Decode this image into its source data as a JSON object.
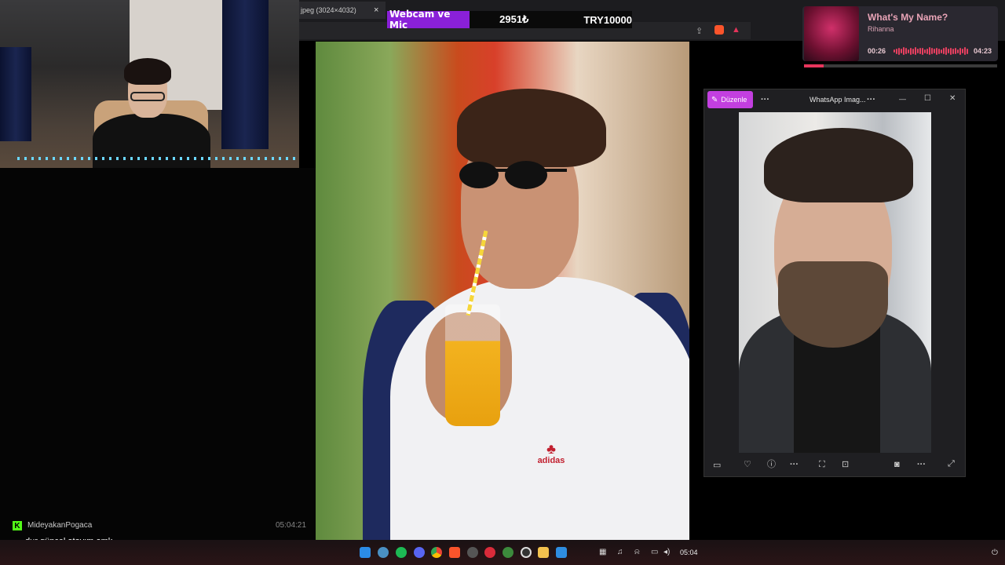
{
  "browser": {
    "tab_title": "jpeg (3024×4032)",
    "tab_close": "×"
  },
  "overlay": {
    "label": "Webcam ve Mic",
    "amount": "2951₺",
    "goal": "TRY10000"
  },
  "music": {
    "title": "What's My Name?",
    "artist": "Rihanna",
    "elapsed": "00:26",
    "duration": "04:23",
    "progress": 0.1,
    "accent": "#e8365d"
  },
  "photos_window": {
    "edit_label": "Düzenle",
    "more": "···",
    "title": "WhatsApp Imag...",
    "title_more": "···",
    "minimize": "—",
    "maximize": "☐",
    "close": "✕",
    "toolbar": [
      "film-strip-icon",
      "heart-icon",
      "info-icon",
      "more-icon",
      "crop-icon",
      "zoom-icon",
      "camera-icon",
      "more-icon",
      "expand-icon"
    ],
    "accent": "#c33fe0"
  },
  "chat": {
    "username": "MideyakanPogaca",
    "timestamp": "05:04:21",
    "message": "dur güncel atayım amk",
    "platform_color": "#53fc18"
  },
  "main_photo": {
    "shirt_logo": "adidas"
  },
  "taskbar": {
    "clock": "05:04",
    "pinned_apps": [
      "windows-start-icon",
      "copilot-icon",
      "spotify-icon",
      "discord-icon",
      "chrome-icon",
      "brave-icon",
      "settings-icon",
      "red-app-icon",
      "xbox-icon",
      "obs-icon",
      "file-explorer-icon",
      "photos-icon"
    ]
  }
}
